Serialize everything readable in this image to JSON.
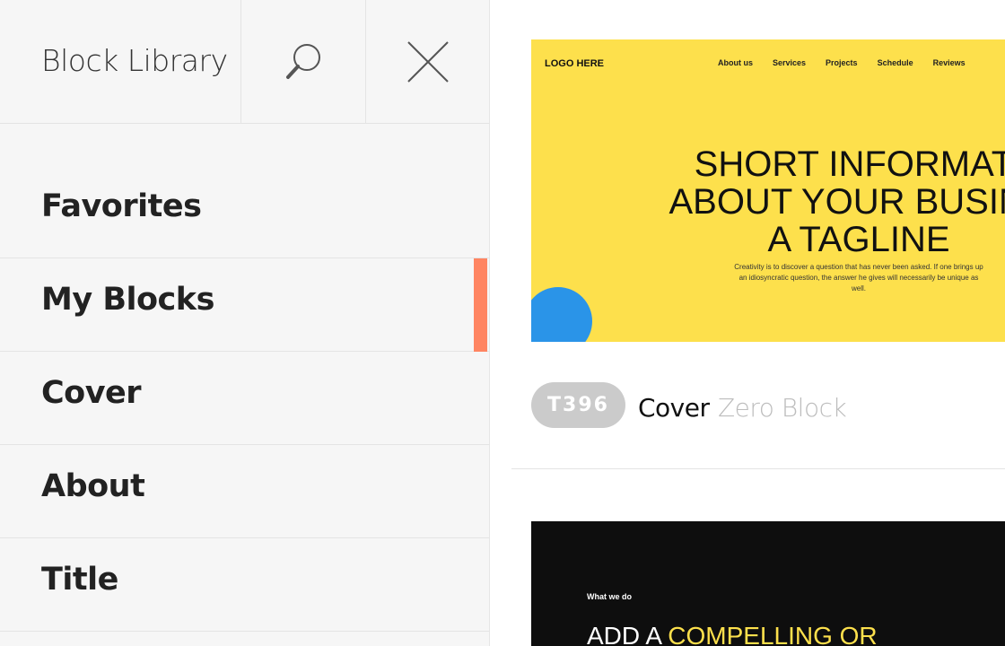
{
  "sidebar": {
    "title": "Block Library",
    "search_icon": "search-icon",
    "close_icon": "close-icon",
    "items": [
      {
        "label": "Favorites"
      },
      {
        "label": "My Blocks"
      },
      {
        "label": "Cover"
      },
      {
        "label": "About"
      },
      {
        "label": "Title"
      }
    ],
    "accent_color": "#ff8562"
  },
  "cards": [
    {
      "preview": {
        "logo": "LOGO HERE",
        "nav": [
          "About us",
          "Services",
          "Projects",
          "Schedule",
          "Reviews"
        ],
        "heading": [
          "SHORT INFORMATI",
          "ABOUT YOUR BUSINE",
          "A TAGLINE"
        ],
        "description": "Creativity is to discover a question that has never been asked. If one brings up an idiosyncratic question, the answer he gives will necessarily be unique as well.",
        "background_color": "#fde04c",
        "shape_color": "#2a94e8"
      },
      "code": "T396",
      "name": "Cover",
      "type": "Zero Block"
    },
    {
      "preview": {
        "small_label": "What we do",
        "heading_prefix": "ADD A ",
        "heading_highlight": "COMPELLING OR",
        "background_color": "#0e0e0e"
      }
    }
  ]
}
